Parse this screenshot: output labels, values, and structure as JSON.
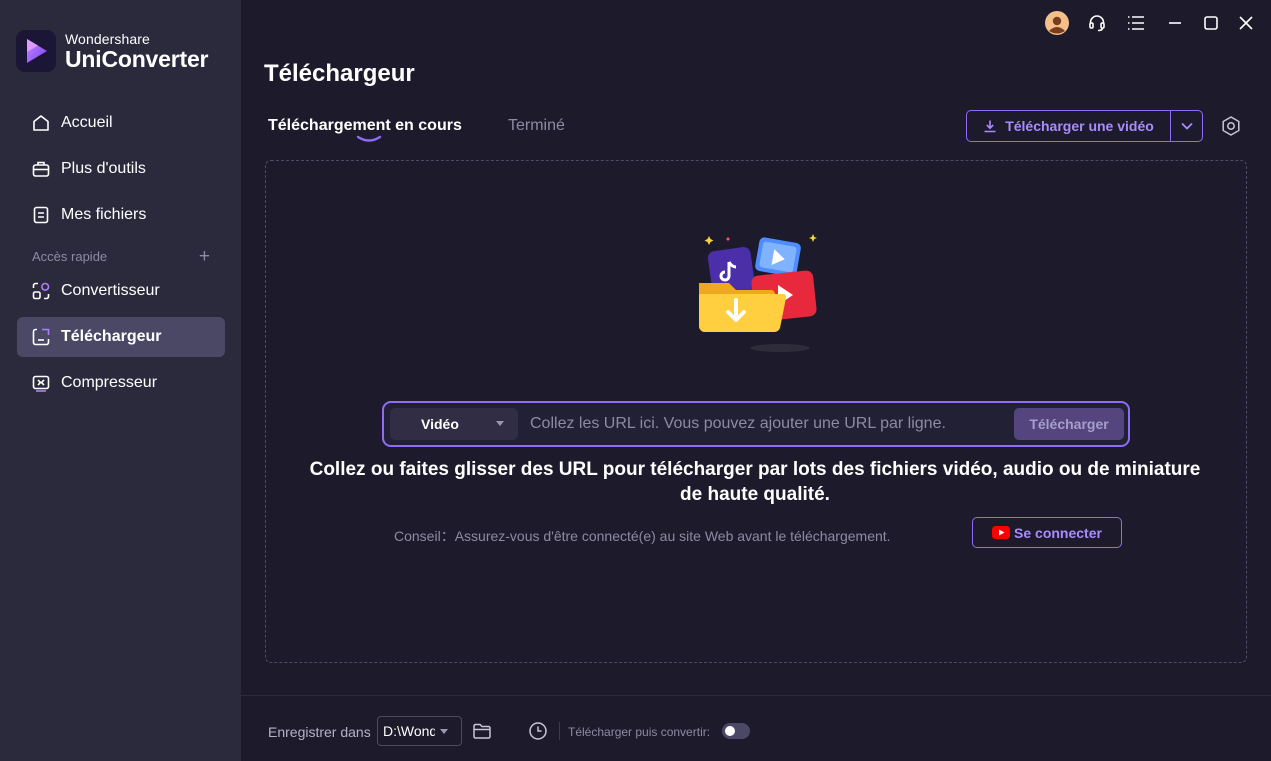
{
  "brand": {
    "company": "Wondershare",
    "product": "UniConverter",
    "logo_icon": "uniconverter-logo-icon"
  },
  "sidebar": {
    "items": [
      {
        "label": "Accueil",
        "icon": "home-icon"
      },
      {
        "label": "Plus d'outils",
        "icon": "toolbox-icon"
      },
      {
        "label": "Mes fichiers",
        "icon": "files-icon"
      }
    ],
    "quick_access": {
      "label": "Accès rapide",
      "add_icon": "plus-icon",
      "add_glyph": "+"
    },
    "quick_items": [
      {
        "label": "Convertisseur",
        "icon": "converter-icon"
      },
      {
        "label": "Téléchargeur",
        "icon": "downloader-icon",
        "active": true
      },
      {
        "label": "Compresseur",
        "icon": "compressor-icon"
      }
    ]
  },
  "titlebar": {
    "icons": [
      "avatar-icon",
      "support-headset-icon",
      "menu-icon",
      "minimize-icon",
      "maximize-icon",
      "close-icon"
    ]
  },
  "main": {
    "title": "Téléchargeur",
    "tabs": [
      {
        "label": "Téléchargement en cours",
        "active": true
      },
      {
        "label": "Terminé",
        "active": false
      }
    ],
    "download_button": {
      "label": "Télécharger une vidéo",
      "icon": "download-icon",
      "dropdown_icon": "chevron-down-icon"
    },
    "settings_icon": "settings-icon",
    "url_bar": {
      "type_value": "Vidéo",
      "placeholder": "Collez les URL ici. Vous pouvez ajouter une URL par ligne.",
      "submit_label": "Télécharger"
    },
    "headline": "Collez ou faites glisser des URL pour télécharger par lots des fichiers vidéo, audio ou de miniature de haute qualité.",
    "tip": "Conseil：Assurez-vous d'être connecté(e) au site Web avant le téléchargement.",
    "login_button": {
      "label": "Se connecter",
      "icon": "youtube-icon"
    }
  },
  "footer": {
    "save_label": "Enregistrer dans",
    "path_value": "D:\\Wondershare UniConverter",
    "folder_icon": "folder-icon",
    "history_icon": "clock-icon",
    "convert_label": "Télécharger puis convertir:",
    "convert_enabled": false
  },
  "colors": {
    "background": "#1d1b2b",
    "sidebar": "#2b2a3d",
    "accent": "#8e6cf5",
    "accent_text": "#a98bff",
    "muted": "#8d8aa3"
  }
}
